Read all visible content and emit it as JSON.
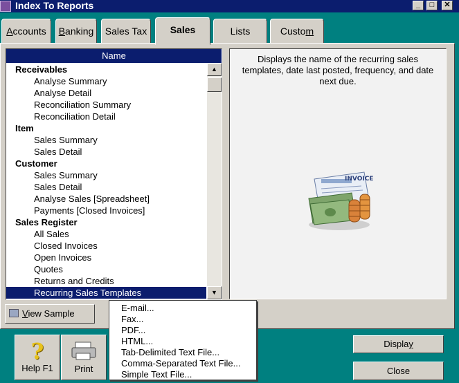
{
  "window": {
    "title": "Index To Reports",
    "min": "_",
    "max": "□",
    "close": "✕"
  },
  "tabs": [
    {
      "label": "Accounts",
      "hotkey": "A",
      "rest": "ccounts"
    },
    {
      "label": "Banking",
      "hotkey": "B",
      "rest": "anking"
    },
    {
      "label": "Sales Tax",
      "hotkey": "",
      "rest": "Sales Tax"
    },
    {
      "label": "Sales",
      "hotkey": "",
      "rest": "Sales"
    },
    {
      "label": "Lists",
      "hotkey": "",
      "rest": "Lists"
    },
    {
      "label": "Custom",
      "hotkey": "m",
      "pre": "Custo"
    }
  ],
  "list": {
    "header": "Name",
    "rows": [
      {
        "type": "cat",
        "text": "Receivables"
      },
      {
        "type": "item",
        "text": "Analyse Summary"
      },
      {
        "type": "item",
        "text": "Analyse Detail"
      },
      {
        "type": "item",
        "text": "Reconciliation Summary"
      },
      {
        "type": "item",
        "text": "Reconciliation Detail"
      },
      {
        "type": "cat",
        "text": "Item"
      },
      {
        "type": "item",
        "text": "Sales Summary"
      },
      {
        "type": "item",
        "text": "Sales Detail"
      },
      {
        "type": "cat",
        "text": "Customer"
      },
      {
        "type": "item",
        "text": "Sales Summary"
      },
      {
        "type": "item",
        "text": "Sales Detail"
      },
      {
        "type": "item",
        "text": "Analyse Sales [Spreadsheet]"
      },
      {
        "type": "item",
        "text": "Payments [Closed Invoices]"
      },
      {
        "type": "cat",
        "text": "Sales Register"
      },
      {
        "type": "item",
        "text": "All Sales"
      },
      {
        "type": "item",
        "text": "Closed Invoices"
      },
      {
        "type": "item",
        "text": "Open Invoices"
      },
      {
        "type": "item",
        "text": "Quotes"
      },
      {
        "type": "item",
        "text": "Returns and Credits"
      },
      {
        "type": "item",
        "text": "Recurring Sales Templates",
        "selected": true
      }
    ]
  },
  "description": "Displays the name of the recurring sales templates, date last posted, frequency, and date next due.",
  "invoice_label": "INVOICE",
  "view_sample": {
    "hotkey": "V",
    "rest": "iew Sample"
  },
  "help": {
    "label": "Help F1",
    "icon": "?"
  },
  "print": {
    "label": "Print"
  },
  "display": {
    "pre": "Displa",
    "hotkey": "y"
  },
  "close": {
    "label": "Close"
  },
  "export_menu": [
    "E-mail...",
    "Fax...",
    "PDF...",
    "HTML...",
    "Tab-Delimited Text File...",
    "Comma-Separated Text File...",
    "Simple Text File..."
  ]
}
